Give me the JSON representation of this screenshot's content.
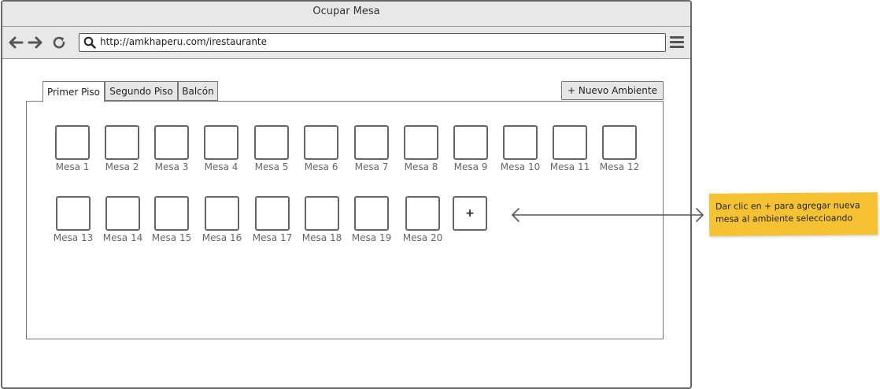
{
  "window": {
    "title": "Ocupar Mesa"
  },
  "browser": {
    "url": "http://amkhaperu.com/irestaurante",
    "icons": [
      "back-arrow-icon",
      "forward-arrow-icon",
      "reload-icon",
      "search-icon",
      "hamburger-menu-icon"
    ]
  },
  "tabs": [
    {
      "label": "Primer Piso",
      "active": true
    },
    {
      "label": "Segundo Piso",
      "active": false
    },
    {
      "label": "Balcón",
      "active": false
    }
  ],
  "new_environment_button": "+ Nuevo Ambiente",
  "tables_row1": [
    "Mesa 1",
    "Mesa 2",
    "Mesa 3",
    "Mesa 4",
    "Mesa 5",
    "Mesa 6",
    "Mesa 7",
    "Mesa 8",
    "Mesa 9",
    "Mesa 10",
    "Mesa 11",
    "Mesa 12"
  ],
  "tables_row2": [
    "Mesa 13",
    "Mesa 14",
    "Mesa 15",
    "Mesa 16",
    "Mesa 17",
    "Mesa 18",
    "Mesa 19",
    "Mesa 20"
  ],
  "add_table_button": "+",
  "note": {
    "line1": "Dar clic en + para agregar nueva",
    "line2": "mesa al ambiente seleccioando",
    "color": "#f4c233"
  }
}
